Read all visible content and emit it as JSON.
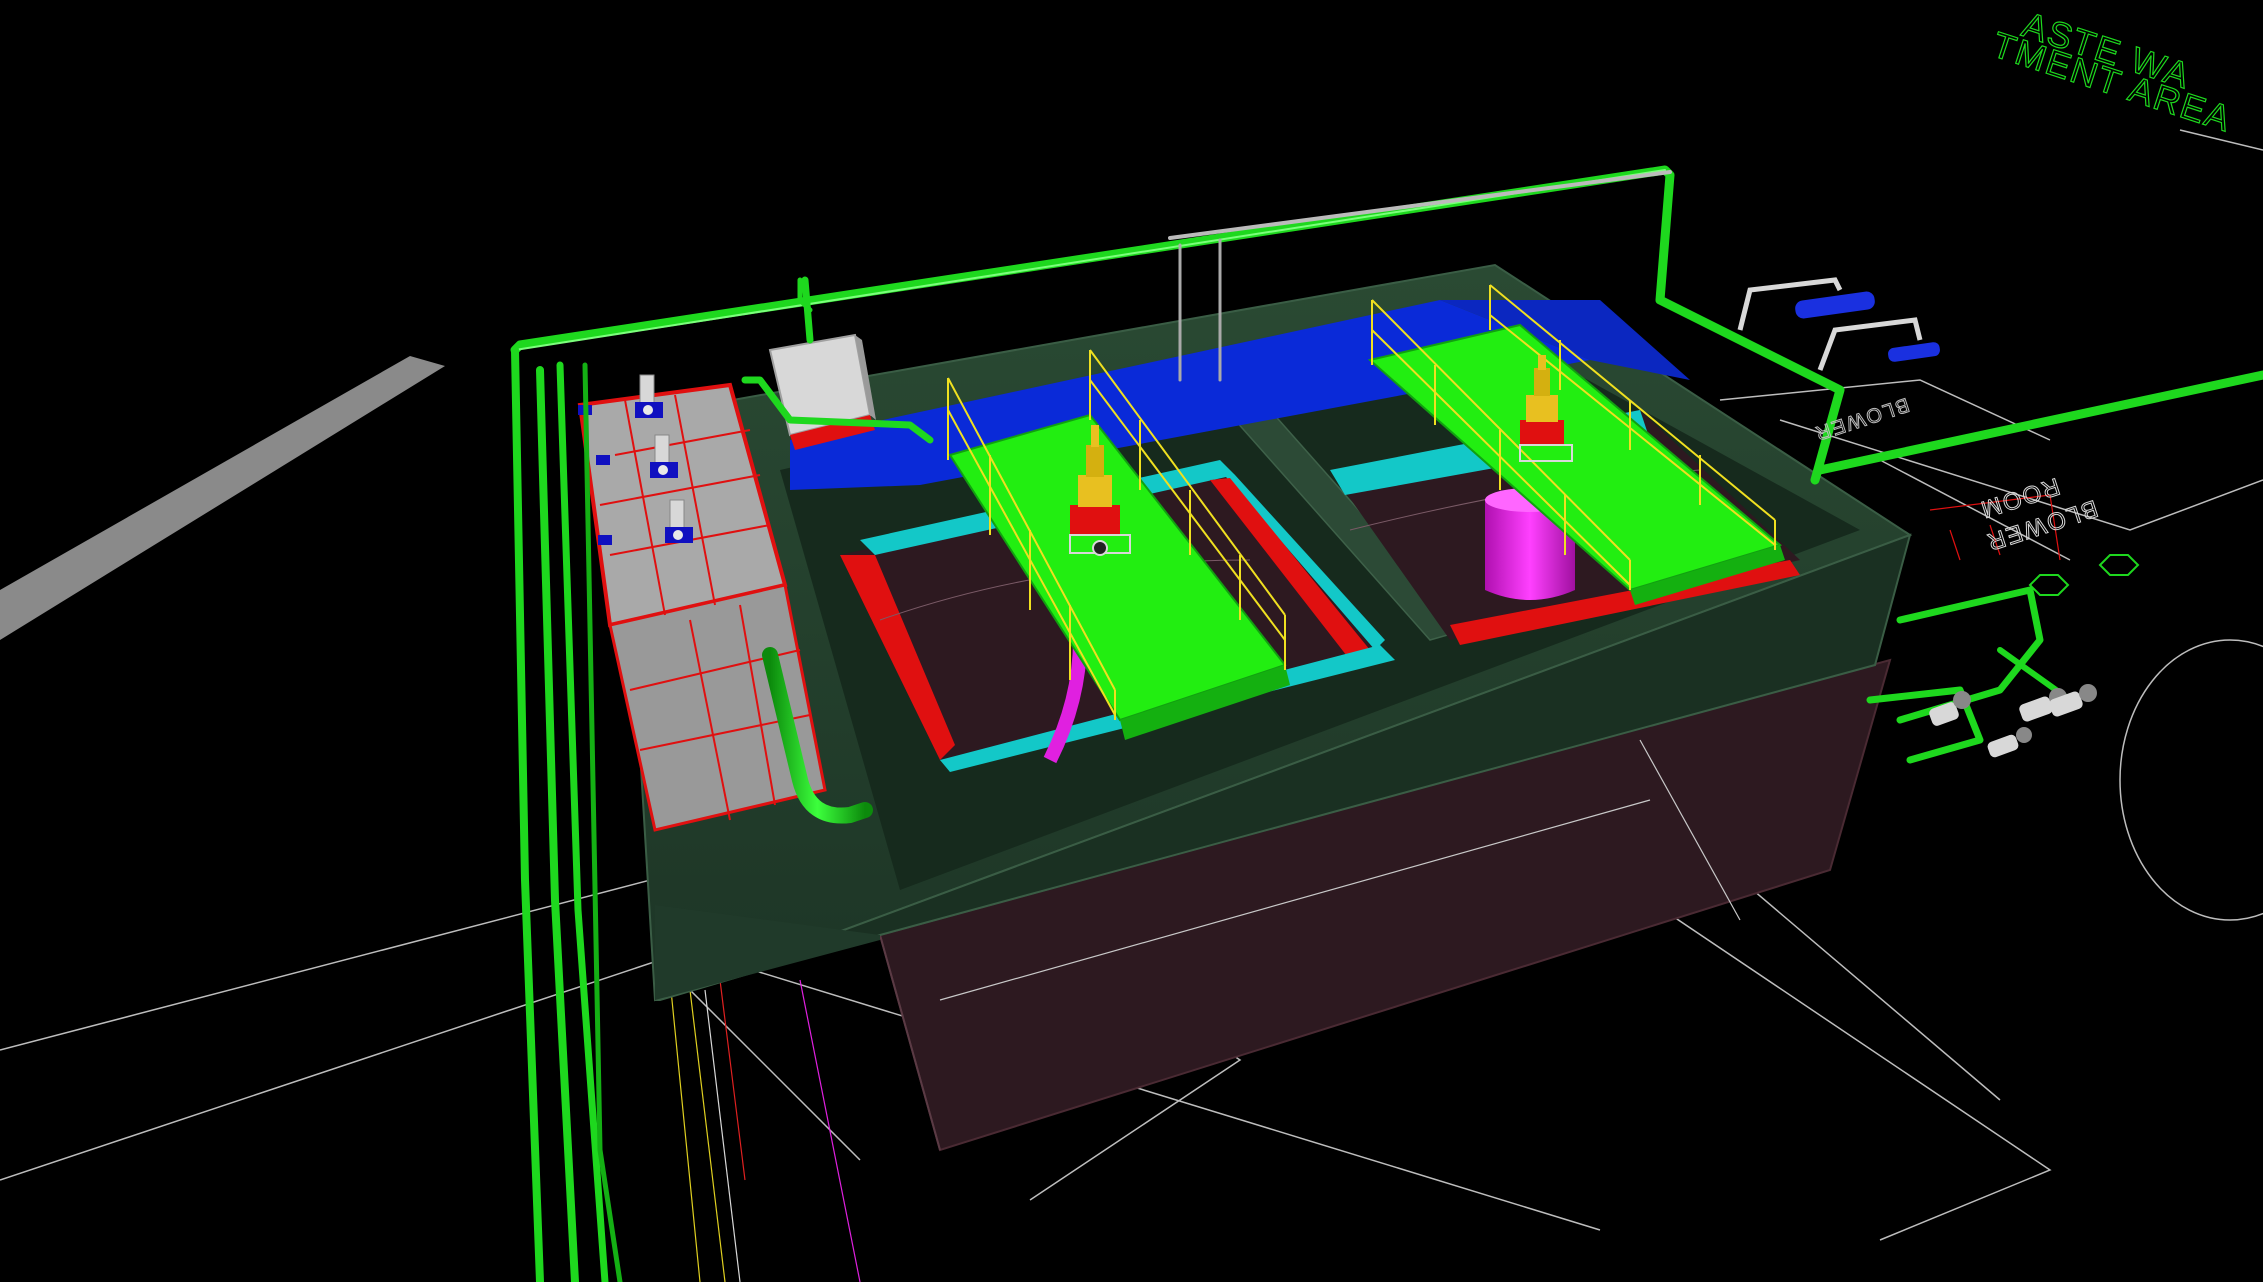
{
  "viewport": {
    "background": "#000000",
    "labels": {
      "area_line1": "ASTE WA",
      "area_line2": "TMENT AREA",
      "blower_small": "BLOWER",
      "blower_room_1": "BLOWER",
      "blower_room_2": "ROOM"
    }
  },
  "colors": {
    "pipe_green": "#1ed81e",
    "pipe_green_dark": "#0f8f0f",
    "walkway_green": "#22ee11",
    "railing_yellow": "#f0e020",
    "water_blue": "#0a2ad8",
    "cyan_liner": "#13c8c8",
    "magenta_pipe": "#e020e0",
    "red_edge": "#e01010",
    "tank_wall": "#1f3a28",
    "tank_body": "#2e1a20",
    "grey_panel": "#a9a9a9",
    "white_equipment": "#d8d8d8"
  },
  "icons": {
    "agitator_left": "mixer-agitator-icon",
    "agitator_right": "mixer-agitator-icon",
    "pumps": "pump-icon",
    "blower_units": "blower-icon"
  }
}
